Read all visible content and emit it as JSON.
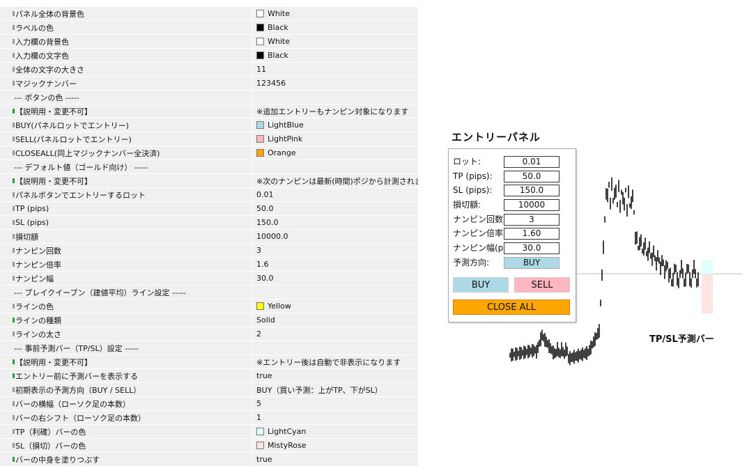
{
  "settings": [
    {
      "name": "パネル全体の背景色",
      "value": "White",
      "swatch": "#ffffff",
      "marker": "gray"
    },
    {
      "name": "ラベルの色",
      "value": "Black",
      "swatch": "#000000",
      "marker": "gray"
    },
    {
      "name": "入力欄の背景色",
      "value": "White",
      "swatch": "#ffffff",
      "marker": "gray"
    },
    {
      "name": "入力欄の文字色",
      "value": "Black",
      "swatch": "#000000",
      "marker": "gray"
    },
    {
      "name": "全体の文字の大きさ",
      "value": "11",
      "marker": "gray"
    },
    {
      "name": "マジックナンバー",
      "value": "123456",
      "marker": "gray"
    },
    {
      "name": "--- ボタンの色 -----",
      "value": "",
      "section": true
    },
    {
      "name": "【説明用・変更不可】",
      "value": "※追加エントリーもナンピン対象になります",
      "marker": "green"
    },
    {
      "name": "BUY(パネルロットでエントリー)",
      "value": "LightBlue",
      "swatch": "#add8e6",
      "marker": "gray"
    },
    {
      "name": "SELL(パネルロットでエントリー)",
      "value": "LightPink",
      "swatch": "#ffb6c1",
      "marker": "gray"
    },
    {
      "name": "CLOSEALL(同上マジックナンバー全決済)",
      "value": "Orange",
      "swatch": "#ffa500",
      "marker": "gray"
    },
    {
      "name": "--- デフォルト値（ゴールド向け） -----",
      "value": "",
      "section": true
    },
    {
      "name": "【説明用・変更不可】",
      "value": "※次のナンピンは最新(時間)ポジから計測されます",
      "marker": "green"
    },
    {
      "name": "パネルボタンでエントリーするロット",
      "value": "0.01",
      "marker": "gray"
    },
    {
      "name": "TP (pips)",
      "value": "50.0",
      "marker": "gray"
    },
    {
      "name": "SL (pips)",
      "value": "150.0",
      "marker": "gray"
    },
    {
      "name": "損切額",
      "value": "10000.0",
      "marker": "gray"
    },
    {
      "name": "ナンピン回数",
      "value": "3",
      "marker": "gray"
    },
    {
      "name": "ナンピン倍率",
      "value": "1.6",
      "marker": "gray"
    },
    {
      "name": "ナンピン幅",
      "value": "30.0",
      "marker": "gray"
    },
    {
      "name": "--- ブレイクイーブン（建値平均）ライン設定 -----",
      "value": "",
      "section": true
    },
    {
      "name": "ラインの色",
      "value": "Yellow",
      "swatch": "#ffff00",
      "marker": "gray"
    },
    {
      "name": "ラインの種類",
      "value": "Solid",
      "marker": "green"
    },
    {
      "name": "ラインの太さ",
      "value": "2",
      "marker": "gray"
    },
    {
      "name": "--- 事前予測バー（TP/SL）設定 -----",
      "value": "",
      "section": true
    },
    {
      "name": "【説明用・変更不可】",
      "value": "※エントリー後は自動で非表示になります",
      "marker": "green"
    },
    {
      "name": "エントリー前に予測バーを表示する",
      "value": "true",
      "marker": "green"
    },
    {
      "name": "初期表示の予測方向（BUY / SELL）",
      "value": "BUY（買い予測：上がTP、下がSL）",
      "marker": "gray"
    },
    {
      "name": "バーの横幅（ローソク足の本数）",
      "value": "5",
      "marker": "gray"
    },
    {
      "name": "バーの右シフト（ローソク足の本数）",
      "value": "1",
      "marker": "gray"
    },
    {
      "name": "TP（利確）バーの色",
      "value": "LightCyan",
      "swatch": "#e0ffff",
      "marker": "gray"
    },
    {
      "name": "SL（損切）バーの色",
      "value": "MistyRose",
      "swatch": "#ffe4e1",
      "marker": "gray"
    },
    {
      "name": "バーの中身を塗りつぶす",
      "value": "true",
      "marker": "green"
    }
  ],
  "panel": {
    "title": "エントリーパネル",
    "rows": [
      {
        "label": "ロット:",
        "value": "0.01"
      },
      {
        "label": "TP (pips):",
        "value": "50.0"
      },
      {
        "label": "SL (pips):",
        "value": "150.0"
      },
      {
        "label": "損切額:",
        "value": "10000"
      },
      {
        "label": "ナンピン回数:",
        "value": "3"
      },
      {
        "label": "ナンピン倍率:",
        "value": "1.60"
      },
      {
        "label": "ナンピン幅(pips):",
        "value": "30.0"
      }
    ],
    "direction_label": "予測方向:",
    "direction_value": "BUY",
    "buy_label": "BUY",
    "sell_label": "SELL",
    "close_all_label": "CLOSE ALL",
    "colors": {
      "buy": "#add8e6",
      "sell": "#ffb6c1",
      "close_all": "#ffa500"
    }
  },
  "chart": {
    "annotation": "TP/SL予測バー",
    "tp_bar_color": "#e0ffff",
    "sl_bar_color": "#ffe4e1"
  }
}
